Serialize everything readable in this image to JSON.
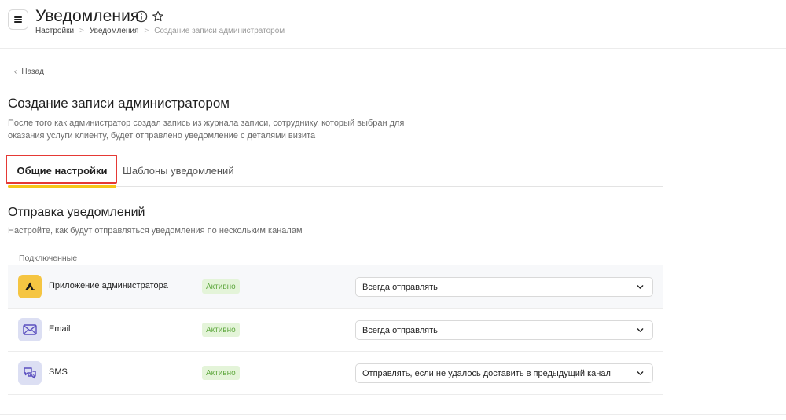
{
  "header": {
    "title": "Уведомления",
    "breadcrumb": [
      "Настройки",
      "Уведомления",
      "Создание записи администратором"
    ]
  },
  "back": {
    "label": "Назад"
  },
  "section": {
    "title": "Создание записи администратором",
    "description": "После того как администратор создал запись из журнала записи, сотруднику, который выбран для оказания услуги клиенту, будет отправлено уведомление с деталями визита"
  },
  "tabs": [
    {
      "label": "Общие настройки",
      "active": true
    },
    {
      "label": "Шаблоны уведомлений",
      "active": false
    }
  ],
  "sending": {
    "title": "Отправка уведомлений",
    "description": "Настройте, как будут отправляться уведомления по нескольким каналам",
    "connected_label": "Подключенные"
  },
  "channels": [
    {
      "name": "Приложение администратора",
      "icon": "admin-app-icon",
      "status": "Активно",
      "option": "Всегда отправлять"
    },
    {
      "name": "Email",
      "icon": "envelope-icon",
      "status": "Активно",
      "option": "Всегда отправлять"
    },
    {
      "name": "SMS",
      "icon": "chat-bubbles-icon",
      "status": "Активно",
      "option": "Отправлять, если не удалось доставить в предыдущий канал"
    }
  ],
  "colors": {
    "accent": "#f5c518",
    "highlight_box": "#e53935",
    "badge_bg": "#e4f4d9",
    "badge_text": "#5fa83f"
  }
}
